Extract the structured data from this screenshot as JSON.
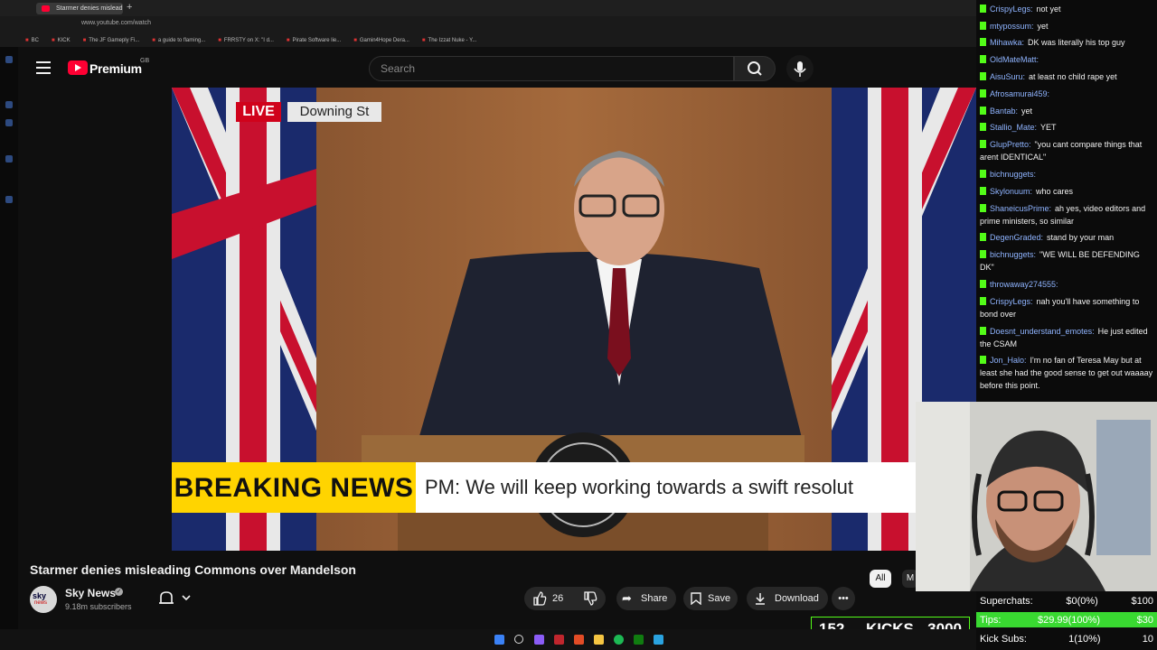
{
  "browser": {
    "tab_title": "Starmer denies mislead",
    "new_tab": "+",
    "url": "www.youtube.com/watch",
    "bookmarks": [
      "BC",
      "KICK",
      "The JF Gameply Fi...",
      "a guide to flaming...",
      "FRRSTY on X: \"I d...",
      "Pirate Software lie...",
      "Gamin4Hope Dera...",
      "The Izzat Nuke - Y..."
    ]
  },
  "youtube": {
    "brand": "Premium",
    "region": "GB",
    "search_placeholder": "Search"
  },
  "video": {
    "live_label": "LIVE",
    "location_label": "Downing St",
    "breaking_label": "BREAKING NEWS",
    "breaking_text": "PM: We will keep working towards a swift resolut",
    "title": "Starmer denies misleading Commons over Mandelson",
    "channel_name": "Sky News",
    "subscribers": "9.18m subscribers",
    "like_count": "26",
    "share_label": "Share",
    "save_label": "Save",
    "download_label": "Download",
    "more_label": "•••",
    "chip_all": "All",
    "chip_more": "M"
  },
  "chat": {
    "messages": [
      {
        "user": "CrispyLegs:",
        "text": "not yet"
      },
      {
        "user": "mtypossum:",
        "text": "yet"
      },
      {
        "user": "Mihawka:",
        "text": "DK was literally his top guy"
      },
      {
        "user": "OldMateMatt:",
        "text": ""
      },
      {
        "user": "AisuSuru:",
        "text": "at least no child rape yet"
      },
      {
        "user": "Afrosamurai459:",
        "text": ""
      },
      {
        "user": "Bantab:",
        "text": "yet"
      },
      {
        "user": "Stallio_Mate:",
        "text": "YET"
      },
      {
        "user": "GlupPretto:",
        "text": "\"you cant compare things that arent IDENTICAL\""
      },
      {
        "user": "bichnuggets:",
        "text": ""
      },
      {
        "user": "Skylonuum:",
        "text": "who cares"
      },
      {
        "user": "ShaneicusPrime:",
        "text": "ah yes, video editors and prime ministers, so similar"
      },
      {
        "user": "DegenGraded:",
        "text": "stand by your man"
      },
      {
        "user": "bichnuggets:",
        "text": "\"WE WILL BE DEFENDING DK\""
      },
      {
        "user": "throwaway274555:",
        "text": ""
      },
      {
        "user": "CrispyLegs:",
        "text": "nah you'll have something to bond over"
      },
      {
        "user": "Doesnt_understand_emotes:",
        "text": "He just edited the CSAM"
      },
      {
        "user": "Jon_Halo:",
        "text": "I'm no fan of Teresa May but at least she had the good sense to get out waaaay before this point."
      }
    ]
  },
  "stats": {
    "superchats_label": "Superchats:",
    "superchats_value": "$0(0%)",
    "superchats_goal": "$100",
    "tips_label": "Tips:",
    "tips_value": "$29.99(100%)",
    "tips_goal": "$30",
    "kicksubs_label": "Kick Subs:",
    "kicksubs_value": "1(10%)",
    "kicksubs_goal": "10",
    "kicks_count": "152",
    "kicks_label": "KICKS",
    "kicks_goal": "3000",
    "tips_progress": 1.0
  },
  "colors": {
    "kick_green": "#53fc18",
    "yt_red": "#ff0033",
    "breaking_yellow": "#ffd400"
  }
}
